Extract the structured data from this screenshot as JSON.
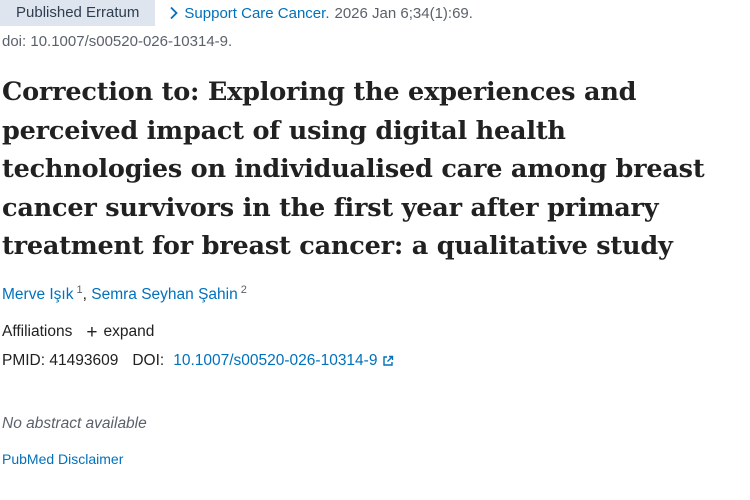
{
  "header": {
    "badge": "Published Erratum",
    "journal": "Support Care Cancer.",
    "citation": "2026 Jan 6;34(1):69.",
    "doi_line": "doi: 10.1007/s00520-026-10314-9."
  },
  "article": {
    "title": "Correction to: Exploring the experiences and perceived impact of using digital health technologies on individualised care among breast cancer survivors in the first year after primary treatment for breast cancer: a qualitative study",
    "authors": [
      {
        "name": "Merve Işık",
        "sup": "1"
      },
      {
        "name": "Semra Seyhan Şahin",
        "sup": "2"
      }
    ],
    "author_separator": ",",
    "affiliations_label": "Affiliations",
    "expand_label": "expand",
    "pmid_label": "PMID: 41493609",
    "doi_label": "DOI:",
    "doi_value": "10.1007/s00520-026-10314-9",
    "abstract": "No abstract available",
    "disclaimer": "PubMed Disclaimer"
  },
  "colors": {
    "link": "#0071bc",
    "badge_bg": "#dfe5ee",
    "muted": "#5b616b"
  },
  "icons": [
    "chevron-right-icon",
    "plus-icon",
    "external-link-icon"
  ]
}
